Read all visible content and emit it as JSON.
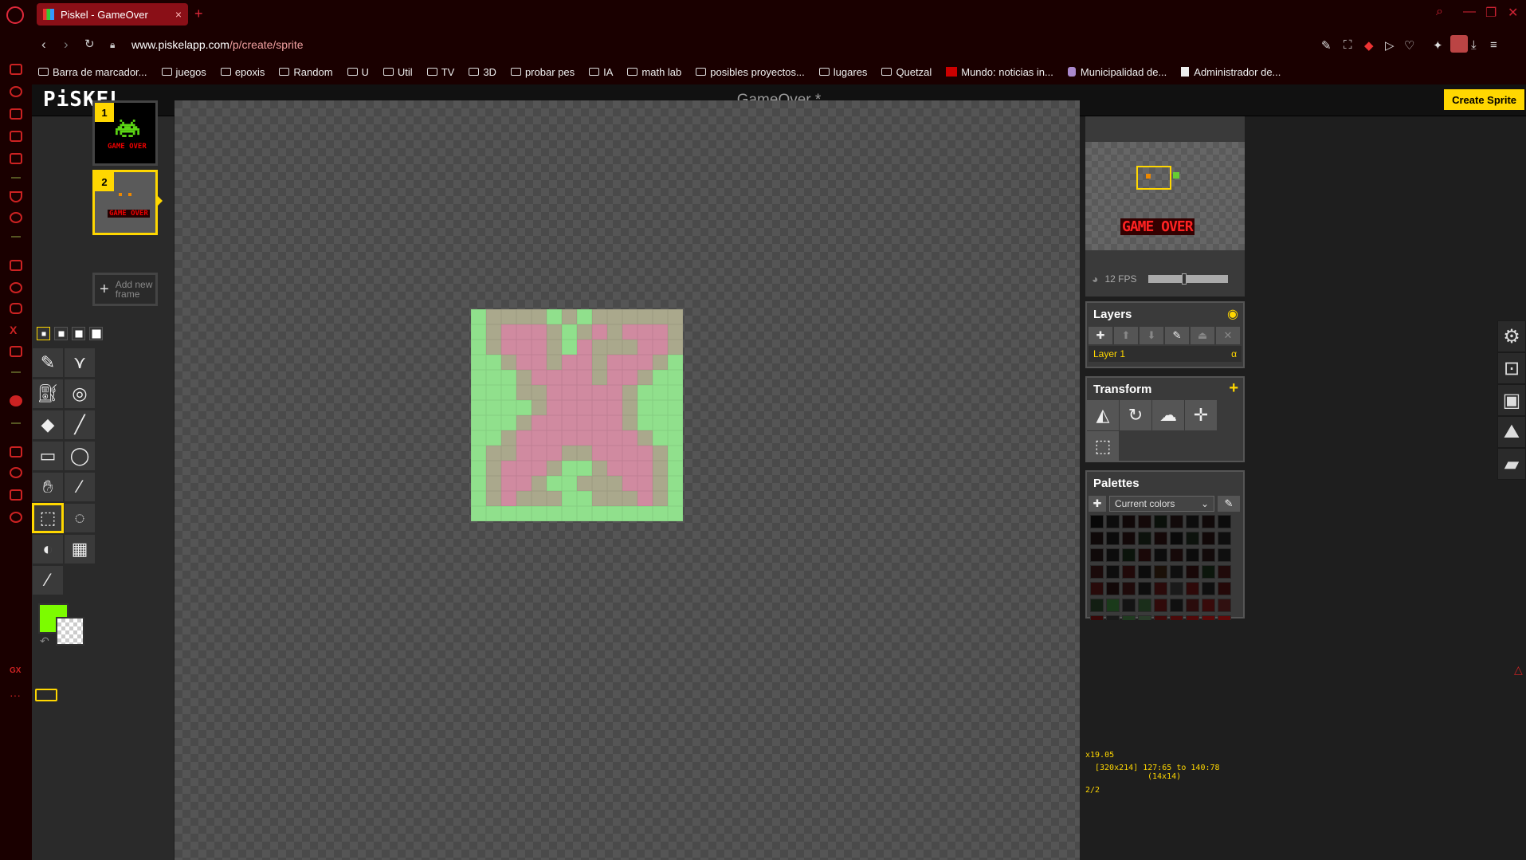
{
  "browser": {
    "tab_title": "Piskel - GameOver",
    "url_host": "www.piskelapp.com",
    "url_path": "/p/create/sprite",
    "bookmarks": [
      "Barra de marcador...",
      "juegos",
      "epoxis",
      "Random",
      "U",
      "Util",
      "TV",
      "3D",
      "probar pes",
      "IA",
      "math lab",
      "posibles proyectos...",
      "lugares",
      "Quetzal",
      "Mundo: noticias in...",
      "Municipalidad de...",
      "Administrador de..."
    ]
  },
  "app": {
    "logo": "PiSKEL",
    "sprite_name": "GameOver *",
    "create_button": "Create Sprite"
  },
  "frames": {
    "items": [
      {
        "number": "1",
        "label": "GAME OVER"
      },
      {
        "number": "2",
        "label": "GAME OVER"
      }
    ],
    "add_label": "Add new frame"
  },
  "tools": {
    "primary_color": "#7cfc00",
    "selected_tool": "rectangle-select"
  },
  "canvas": {
    "sprite_size": 14,
    "colors": {
      "G": "#90e08c",
      "P": "#d08aa0",
      "M": "#aaa88c"
    },
    "rows": [
      "GMMMMGMGMMMMMM",
      "GMPPPMGMPMPPPM",
      "GMPPPMGPMMMPPM",
      "GGMPPMPPMPPPMG",
      "GGGMPPPPMPPMGG",
      "GGGMMPPPPPMGGG",
      "GGGGMPPPPPMGGG",
      "GGGMPPPPPPMGGG",
      "GGMPPPPPPPPMGG",
      "GMMPPPMMPPPPMG",
      "GMPPPMGGMPPPMG",
      "GMPPMGGMMMPPMG",
      "GMPMMMGGMMMPMG",
      "GGGGGGGGGGGGGG"
    ]
  },
  "preview": {
    "label": "GAME OVER",
    "fps": "12 FPS",
    "fps_value": 12,
    "fps_fraction": 0.45
  },
  "layers": {
    "title": "Layers",
    "items": [
      {
        "name": "Layer 1",
        "alpha": "α"
      }
    ]
  },
  "transform": {
    "title": "Transform"
  },
  "palettes": {
    "title": "Palettes",
    "selected": "Current colors",
    "swatches": [
      "#080808",
      "#0d0d0d",
      "#100808",
      "#140909",
      "#0a100a",
      "#120a0a",
      "#0d0d0d",
      "#100909",
      "#0c0c0c",
      "#0f0909",
      "#0b0b0b",
      "#120808",
      "#0c120c",
      "#140808",
      "#0a0a0a",
      "#0d130d",
      "#110808",
      "#0e0e0e",
      "#100a0a",
      "#0c0c0c",
      "#0b140b",
      "#1a0808",
      "#0c0c0c",
      "#160909",
      "#0c0c0c",
      "#120a0a",
      "#0f0f0f",
      "#1a0a0a",
      "#0d0d0d",
      "#200909",
      "#0c0c0c",
      "#1a1008",
      "#0f0f0f",
      "#180808",
      "#0c160c",
      "#200a0a",
      "#280a0a",
      "#120808",
      "#1e0a0a",
      "#0d0d0d",
      "#2a0a0a",
      "#1a1a1a",
      "#2e0909",
      "#0f0f0f",
      "#240808",
      "#121e12",
      "#1a3a1a",
      "#141414",
      "#1a2e1a",
      "#300a0a",
      "#101010",
      "#2a0c0c",
      "#380a0a",
      "#301010",
      "#380808",
      "#1a1a1a",
      "#203a20",
      "#2a3c2a",
      "#400a0a",
      "#4a0a0a",
      "#500a0a",
      "#5a0a0a",
      "#600a0a",
      "#6a0808",
      "#700808",
      "#7a0a0a",
      "#800a0a",
      "#8a0a0a",
      "#900a0a",
      "#9a0a0a",
      "#a00a0a",
      "#aa0808"
    ]
  },
  "status": {
    "zoom": "x19.05",
    "coords": "[320x214] 127:65 to 140:78",
    "selection": "(14x14)",
    "frame": "2/2"
  }
}
